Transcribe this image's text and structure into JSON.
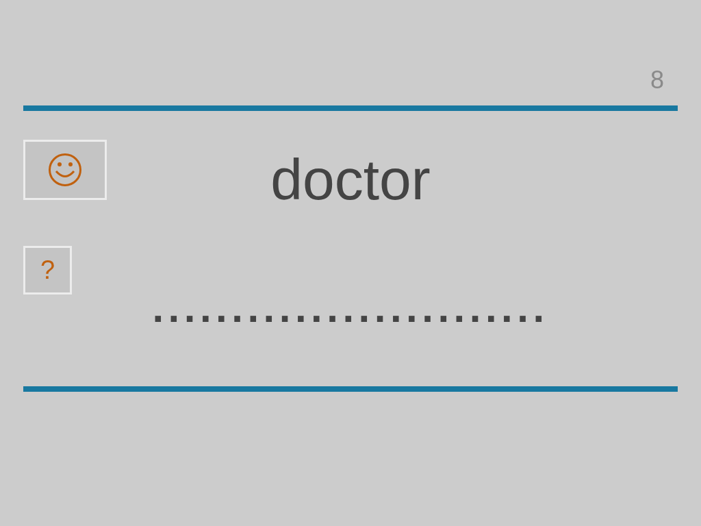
{
  "page_number": "8",
  "hint_button": {
    "kind": "smiley"
  },
  "help_button": {
    "label": "?"
  },
  "word": "doctor",
  "answer_line": "........................."
}
